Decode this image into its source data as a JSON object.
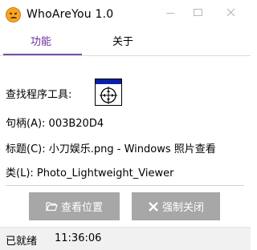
{
  "window": {
    "title": "WhoAreYou 1.0",
    "icon": "angry-face-icon",
    "controls": [
      "minimize-icon",
      "maximize-icon",
      "close-icon"
    ]
  },
  "tabs": [
    {
      "label": "功能",
      "active": true
    },
    {
      "label": "关于",
      "active": false
    }
  ],
  "accent_color": "#7d4ea8",
  "fields": {
    "finder_label": "查找程序工具:",
    "handle": "句柄(A): 003B20D4",
    "title": "标题(C): 小刀娱乐.png - Windows 照片查看",
    "class": "类(L): Photo_Lightweight_Viewer"
  },
  "buttons": {
    "view_location": "查看位置",
    "force_close": "强制关闭"
  },
  "status": {
    "text": "已就绪",
    "time": "11:36:06"
  }
}
